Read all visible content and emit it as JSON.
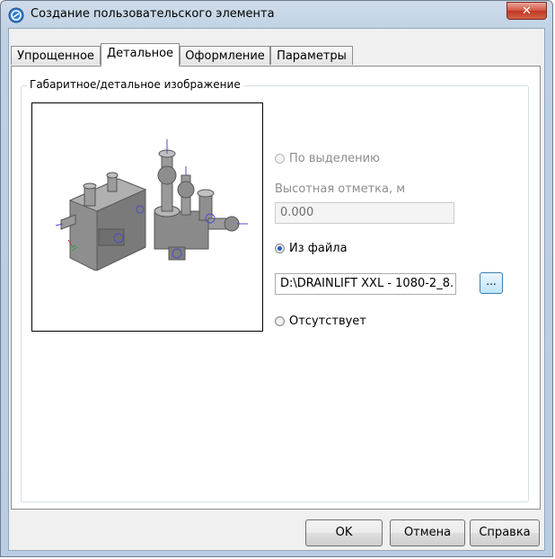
{
  "window": {
    "title": "Создание пользовательского элемента",
    "close_icon": "close-x-icon",
    "close_label": "✕"
  },
  "tabs": [
    {
      "label": "Упрощенное",
      "active": false
    },
    {
      "label": "Детальное",
      "active": true
    },
    {
      "label": "Оформление",
      "active": false
    },
    {
      "label": "Параметры",
      "active": false
    }
  ],
  "group": {
    "legend": "Габаритное/детальное изображение",
    "preview_icon": "3d-equipment-preview"
  },
  "options": {
    "by_selection": {
      "label": "По выделению",
      "checked": false,
      "enabled": false
    },
    "elevation_label": "Высотная отметка, м",
    "elevation_value": "0.000",
    "from_file": {
      "label": "Из файла",
      "checked": true
    },
    "file_path": "D:\\DRAINLIFT XXL - 1080-2_8.",
    "browse_label": "...",
    "absent": {
      "label": "Отсутствует",
      "checked": false
    }
  },
  "buttons": {
    "ok": "OK",
    "cancel": "Отмена",
    "help": "Справка"
  },
  "colors": {
    "accent": "#1e5fbf",
    "close_button": "#c8432b",
    "title_bar": "#c4d5e8"
  }
}
